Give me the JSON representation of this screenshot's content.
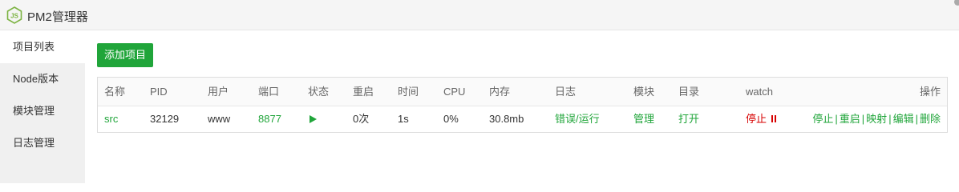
{
  "app": {
    "title": "PM2管理器"
  },
  "colors": {
    "accent": "#20a53a",
    "danger": "#d70000",
    "sidebar_bg": "#f0f0f0"
  },
  "icons": {
    "logo": "nodejs-hex-icon",
    "play": "play-icon",
    "pause": "pause-icon"
  },
  "sidebar": {
    "items": [
      {
        "label": "项目列表",
        "active": true
      },
      {
        "label": "Node版本",
        "active": false
      },
      {
        "label": "模块管理",
        "active": false
      },
      {
        "label": "日志管理",
        "active": false
      }
    ]
  },
  "toolbar": {
    "add_label": "添加项目"
  },
  "table": {
    "headers": {
      "name": "名称",
      "pid": "PID",
      "user": "用户",
      "port": "端口",
      "status": "状态",
      "restart": "重启",
      "time": "时间",
      "cpu": "CPU",
      "memory": "内存",
      "log": "日志",
      "module": "模块",
      "dir": "目录",
      "watch": "watch",
      "ops": "操作"
    },
    "rows": [
      {
        "name": "src",
        "pid": "32129",
        "user": "www",
        "port": "8877",
        "status": "running",
        "restart": "0次",
        "time": "1s",
        "cpu": "0%",
        "memory": "30.8mb",
        "log": "错误/运行",
        "module": "管理",
        "dir": "打开",
        "watch": "停止",
        "ops": {
          "stop": "停止",
          "restart": "重启",
          "map": "映射",
          "edit": "编辑",
          "delete": "删除",
          "separator": "|"
        }
      }
    ]
  }
}
